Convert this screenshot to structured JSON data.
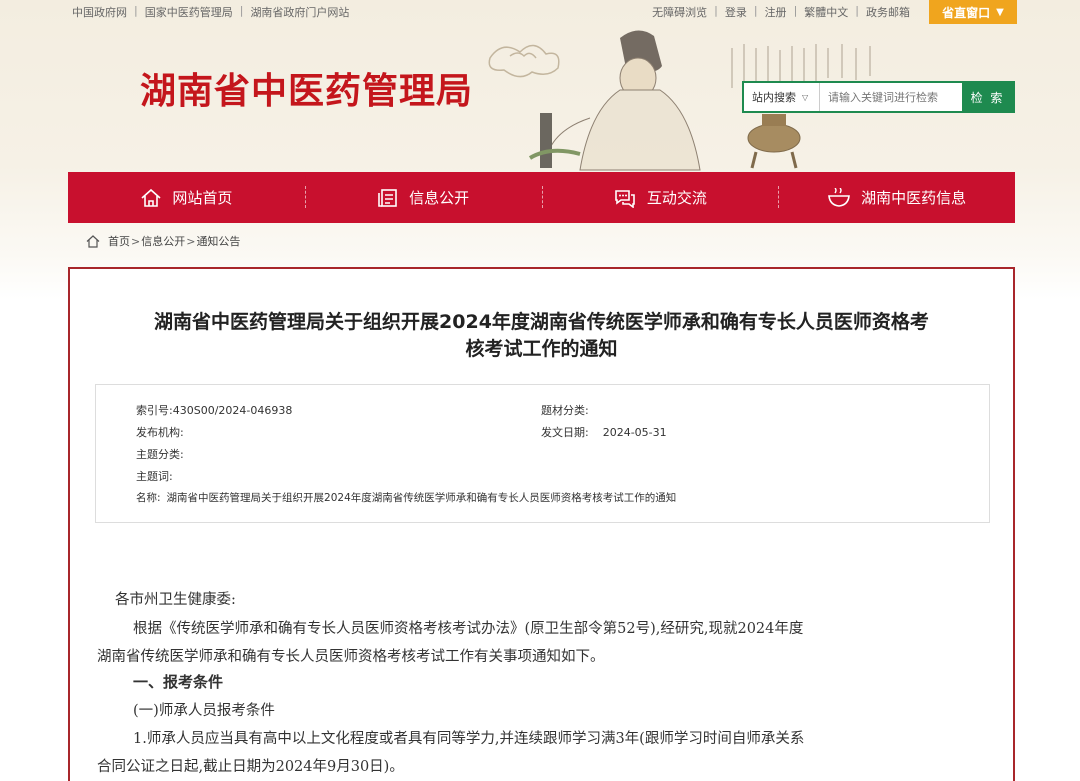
{
  "topbar": {
    "left_links": [
      "中国政府网",
      "国家中医药管理局",
      "湖南省政府门户网站"
    ],
    "right_links": [
      "无障碍浏览",
      "登录",
      "注册",
      "繁體中文",
      "政务邮箱"
    ],
    "province_window": "省直窗口"
  },
  "header": {
    "site_title": "湖南省中医药管理局"
  },
  "search": {
    "scope": "站内搜索",
    "placeholder": "请输入关键词进行检索",
    "button": "检 索"
  },
  "nav": {
    "items": [
      {
        "label": "网站首页",
        "icon": "home-icon"
      },
      {
        "label": "信息公开",
        "icon": "document-icon"
      },
      {
        "label": "互动交流",
        "icon": "chat-icon"
      },
      {
        "label": "湖南中医药信息",
        "icon": "bowl-icon"
      }
    ]
  },
  "breadcrumb": {
    "items": [
      "首页",
      "信息公开",
      "通知公告"
    ],
    "separator": ">"
  },
  "article": {
    "title_line1": "湖南省中医药管理局关于组织开展2024年度湖南省传统医学师承和确有专长人员医师资格考",
    "title_line2": "核考试工作的通知",
    "meta": {
      "index_label": "索引号:",
      "index_value": "430S00/2024-046938",
      "category_label": "题材分类:",
      "category_value": "",
      "publisher_label": "发布机构:",
      "publisher_value": "",
      "date_label": "发文日期:",
      "date_value": "2024-05-31",
      "topic_label": "主题分类:",
      "topic_value": "",
      "keywords_label": "主题词:",
      "keywords_value": "",
      "name_label": "名称:",
      "name_value": "湖南省中医药管理局关于组织开展2024年度湖南省传统医学师承和确有专长人员医师资格考核考试工作的通知"
    },
    "body": {
      "salutation": "各市州卫生健康委:",
      "p1_line1": "根据《传统医学师承和确有专长人员医师资格考核考试办法》(原卫生部令第52号),经研究,现就2024年度",
      "p1_line2": "湖南省传统医学师承和确有专长人员医师资格考核考试工作有关事项通知如下。",
      "heading1": "一、报考条件",
      "sub1": "(一)师承人员报考条件",
      "p2_line1": "1.师承人员应当具有高中以上文化程度或者具有同等学力,并连续跟师学习满3年(跟师学习时间自师承关系",
      "p2_line2": "合同公证之日起,截止日期为2024年9月30日)。"
    }
  },
  "colors": {
    "brand_red": "#c8102e",
    "title_red": "#c4161c",
    "search_green": "#1e8a4f",
    "window_orange": "#f0a51e"
  }
}
